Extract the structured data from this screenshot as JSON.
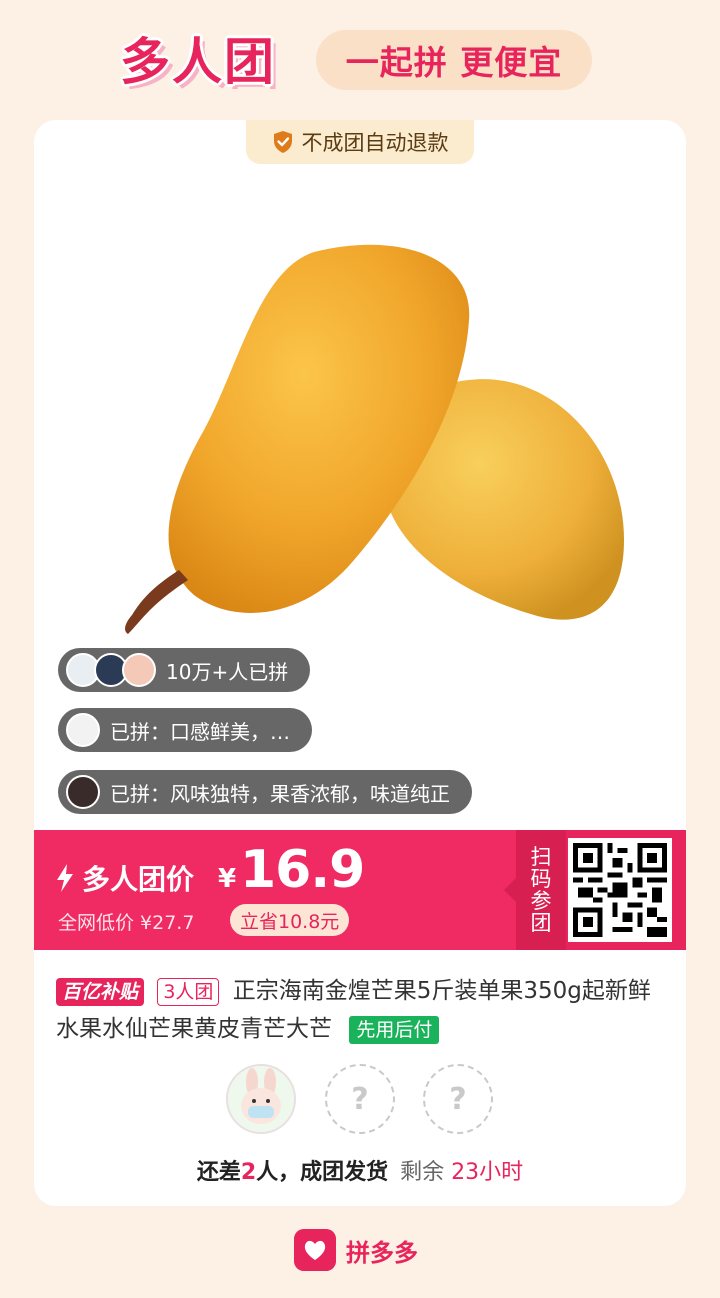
{
  "header": {
    "brand": "多人团",
    "slogan": "一起拼 更便宜"
  },
  "card": {
    "refund_tag": "不成团自动退款",
    "social": {
      "joined_count": "10万+人已拼",
      "review_1": "已拼：口感鲜美，…",
      "review_2": "已拼：风味独特，果香浓郁，味道纯正"
    },
    "price": {
      "label": "多人团价",
      "currency": "¥",
      "value": "16.9",
      "net_low": "全网低价 ¥27.7",
      "save": "立省10.8元",
      "scan": "扫码参团"
    },
    "product": {
      "badge_subsidy": "百亿补贴",
      "badge_group": "3人团",
      "title": "正宗海南金煌芒果5斤装单果350g起新鲜水果水仙芒果黄皮青芒大芒",
      "badge_pay_later": "先用后付"
    },
    "group": {
      "slot_placeholder": "?",
      "status_prefix": "还差",
      "missing": "2",
      "status_suffix": "人，成团发货",
      "remaining": "剩余",
      "time_left": "23小时"
    }
  },
  "footer": {
    "app_name": "拼多多"
  },
  "colors": {
    "accent": "#e8245c",
    "background": "#fdf1e6",
    "pay_later": "#1ab25a"
  }
}
